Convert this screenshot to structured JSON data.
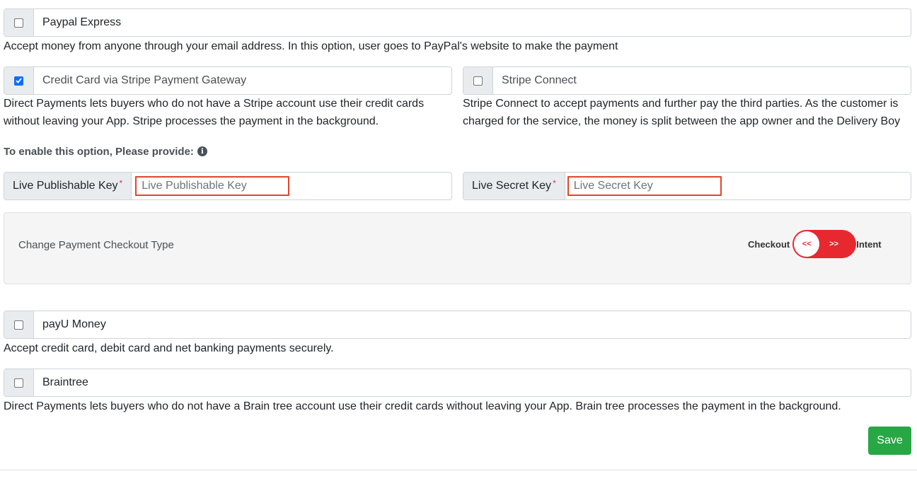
{
  "paypal": {
    "label": "Paypal Express",
    "checked": false,
    "description": "Accept money from anyone through your email address. In this option, user goes to PayPal's website to make the payment"
  },
  "stripe": {
    "label": "Credit Card via Stripe Payment Gateway",
    "checked": true,
    "description_line1": "Direct Payments lets buyers who do not have a Stripe account use their credit cards",
    "description_line2": "without leaving your App. Stripe processes the payment in the background."
  },
  "stripe_connect": {
    "label": "Stripe Connect",
    "checked": false,
    "description_line1": "Stripe Connect to accept payments and further pay the third parties. As the customer is",
    "description_line2": "charged for the service, the money is split between the app owner and the Delivery Boy"
  },
  "provide": {
    "text": "To enable this option, Please provide:",
    "icon": "info-circle-icon"
  },
  "publishable_key": {
    "label": "Live Publishable Key",
    "required_mark": "*",
    "placeholder": "Live Publishable Key",
    "value": ""
  },
  "secret_key": {
    "label": "Live Secret Key",
    "required_mark": "*",
    "placeholder": "Live Secret Key",
    "value": ""
  },
  "checkout_type": {
    "title": "Change Payment Checkout Type",
    "left_label": "Checkout",
    "right_label": "Intent",
    "knob_text": "<<",
    "track_text": ">>",
    "selected": "Checkout",
    "track_color": "#e8282f"
  },
  "payu": {
    "label": "payU Money",
    "checked": false,
    "description": "Accept credit card, debit card and net banking payments securely."
  },
  "braintree": {
    "label": "Braintree",
    "checked": false,
    "description": "Direct Payments lets buyers who do not have a Brain tree account use their credit cards without leaving your App. Brain tree processes the payment in the background."
  },
  "save_button": {
    "label": "Save",
    "color": "#28a745"
  }
}
